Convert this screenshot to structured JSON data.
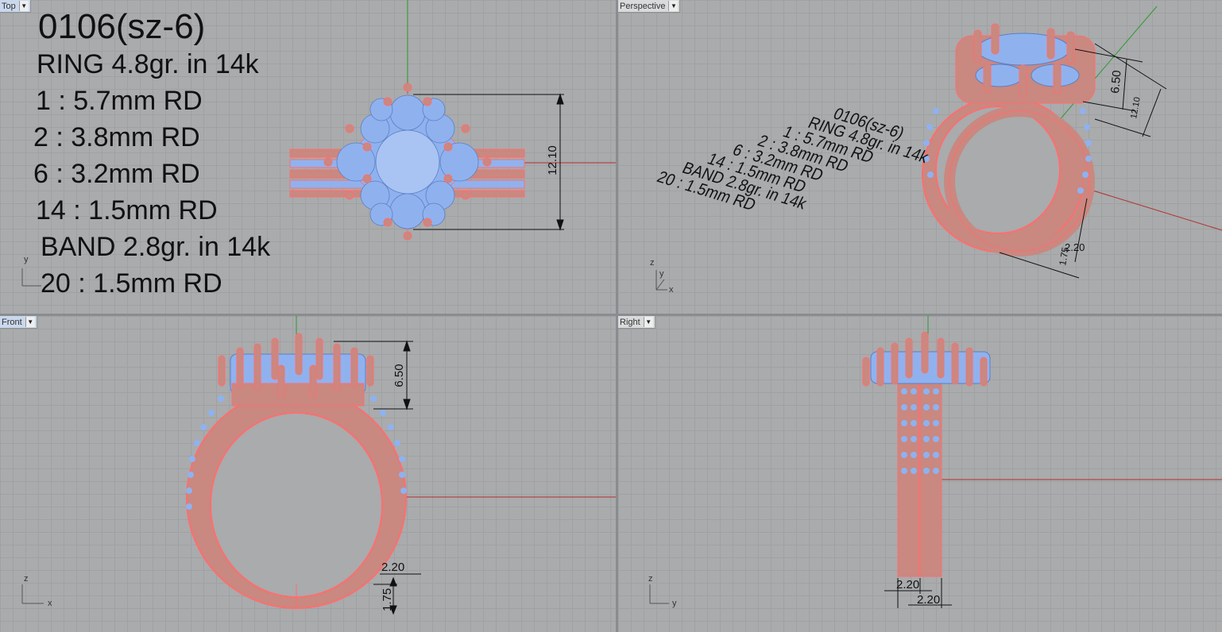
{
  "viewports": {
    "top": {
      "label": "Top"
    },
    "perspective": {
      "label": "Perspective"
    },
    "front": {
      "label": "Front"
    },
    "right": {
      "label": "Right"
    }
  },
  "annotation": {
    "lines": [
      "0106(sz-6)",
      "RING 4.8gr.  in 14k",
      "1 : 5.7mm RD",
      "2 : 3.8mm RD",
      "6 : 3.2mm RD",
      "14 : 1.5mm RD",
      "BAND 2.8gr.  in 14k",
      "20 : 1.5mm RD"
    ]
  },
  "dimensions": {
    "head_width": "12.10",
    "head_height": "6.50",
    "shank_width": "2.20",
    "shank_thickness": "1.75",
    "band_width": "2.20"
  },
  "axes": {
    "x": "x",
    "y": "y",
    "z": "z"
  },
  "colors": {
    "viewport_bg": "#a9abad",
    "grid": "#9fa1a3",
    "metal": "#c98880",
    "metal_edge": "#ff6e6e",
    "stone": "#8fb2ef",
    "x_axis": "#b3312c",
    "y_axis": "#2f9a2f"
  }
}
